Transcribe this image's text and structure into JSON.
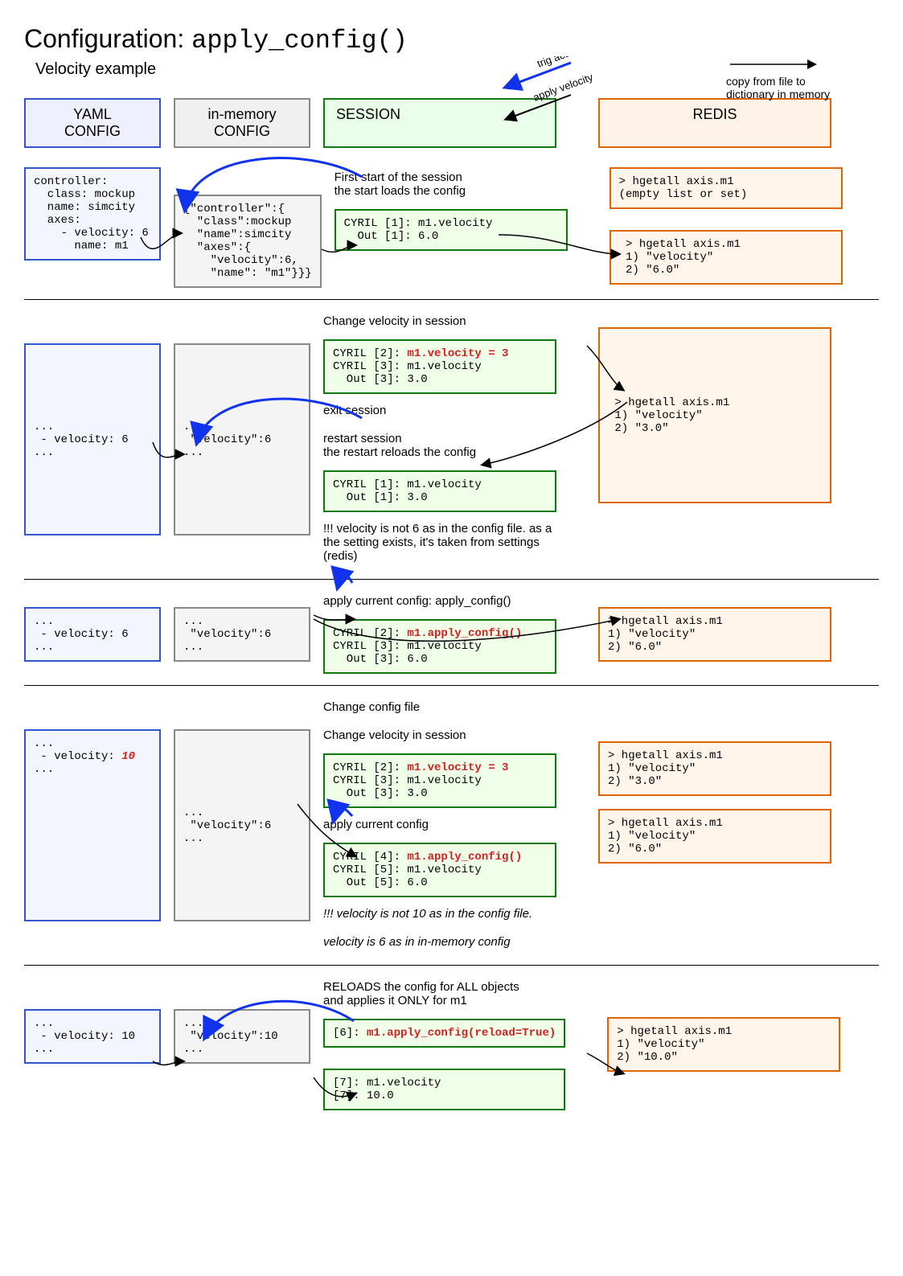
{
  "title_prefix": "Configuration: ",
  "title_code": "apply_config()",
  "subtitle": "Velocity example",
  "legend": {
    "trig": "trig action",
    "apply": "apply velocity",
    "copy": "copy from file to dictionary in memory"
  },
  "columns": {
    "yaml": "YAML\nCONFIG",
    "mem": "in-memory\nCONFIG",
    "session": "SESSION",
    "redis": "REDIS"
  },
  "s1": {
    "yaml": "controller:\n  class: mockup\n  name: simcity\n  axes:\n    - velocity: 6\n      name: m1",
    "mem": "{\"controller\":{\n  \"class\":mockup\n  \"name\":simcity\n  \"axes\":{\n    \"velocity\":6,\n    \"name\": \"m1\"}}}",
    "sess_note": "First start of the session\nthe start loads the config",
    "sess": "CYRIL [1]: m1.velocity\n  Out [1]: 6.0",
    "redis_top": "> hgetall axis.m1\n(empty list or set)",
    "redis_bot": " > hgetall axis.m1\n 1) \"velocity\"\n 2) \"6.0\""
  },
  "s2": {
    "yaml": "...\n - velocity: 6\n...",
    "mem": "...\n \"velocity\":6\n...",
    "note_top": "Change velocity in session",
    "sess_a_pre": "CYRIL [2]: ",
    "sess_a_red": "m1.velocity = 3",
    "sess_a_rest": "\nCYRIL [3]: m1.velocity\n  Out [3]: 3.0",
    "note_mid1": "exit session",
    "note_mid2": "restart session\nthe restart reloads the config",
    "sess_b": "CYRIL [1]: m1.velocity\n  Out [1]: 3.0",
    "note_bot": "!!! velocity is not 6 as in the config file.\nas a the setting exists, it's taken from settings (redis)",
    "redis": " > hgetall axis.m1\n 1) \"velocity\"\n 2) \"3.0\""
  },
  "s3": {
    "yaml": "...\n - velocity: 6\n...",
    "mem": "...\n \"velocity\":6\n...",
    "note_top": "apply current config: apply_config()",
    "sess_pre": "CYRIL [2]: ",
    "sess_red": "m1.apply_config()",
    "sess_rest": "\nCYRIL [3]: m1.velocity\n  Out [3]: 6.0",
    "redis": "> hgetall axis.m1\n1) \"velocity\"\n2) \"6.0\""
  },
  "s4": {
    "yaml_pre": "...\n - velocity: ",
    "yaml_red": "10",
    "yaml_post": "\n...",
    "mem": "...\n \"velocity\":6\n...",
    "note_top1": "Change config file",
    "note_top2": "Change velocity in session",
    "sess_a_pre": "CYRIL [2]: ",
    "sess_a_red": "m1.velocity = 3",
    "sess_a_rest": "\nCYRIL [3]: m1.velocity\n  Out [3]: 3.0",
    "note_mid": "apply current config",
    "sess_b_pre": "CYRIL [4]: ",
    "sess_b_red": "m1.apply_config()",
    "sess_b_rest": "\nCYRIL [5]: m1.velocity\n  Out [5]: 6.0",
    "note_bot1": "!!! velocity is not 10 as in the config file.",
    "note_bot2": "velocity is 6 as in in-memory config",
    "redis_a": "> hgetall axis.m1\n1) \"velocity\"\n2) \"3.0\"",
    "redis_b": "> hgetall axis.m1\n1) \"velocity\"\n2) \"6.0\""
  },
  "s5": {
    "yaml": "...\n - velocity: 10\n...",
    "mem": "...\n \"velocity\":10\n...",
    "note_top": "RELOADS the config for ALL objects\nand applies it ONLY for m1",
    "sess_a_pre": "[6]: ",
    "sess_a_red": "m1.apply_config(reload=True)",
    "sess_b": "[7]: m1.velocity\n[7]: 10.0",
    "redis": "> hgetall axis.m1\n1) \"velocity\"\n2) \"10.0\""
  }
}
